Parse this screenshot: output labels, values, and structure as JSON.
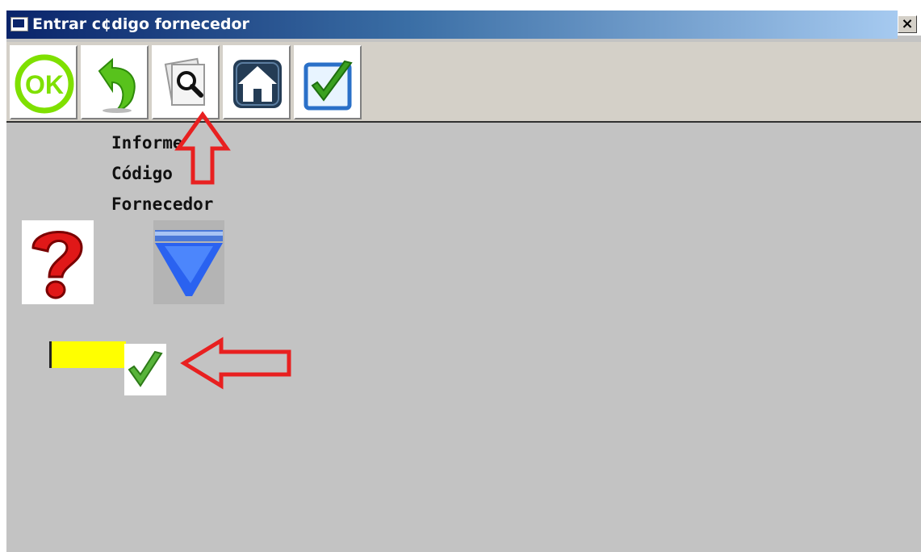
{
  "window": {
    "title": "Entrar c¢digo fornecedor",
    "close_label": "×"
  },
  "toolbar": {
    "buttons": [
      {
        "name": "ok-button",
        "icon": "ok-icon",
        "label": "OK"
      },
      {
        "name": "back-button",
        "icon": "undo-arrow-icon"
      },
      {
        "name": "search-button",
        "icon": "search-icon"
      },
      {
        "name": "home-button",
        "icon": "home-icon"
      },
      {
        "name": "confirm-button",
        "icon": "check-box-icon"
      }
    ]
  },
  "prompt": {
    "line1": "Informe",
    "line2": "Código",
    "line3": "Fornecedor"
  },
  "input": {
    "value": ""
  },
  "colors": {
    "background": "#c3c3c3",
    "input": "#ffff00",
    "annotation": "#e82020"
  }
}
